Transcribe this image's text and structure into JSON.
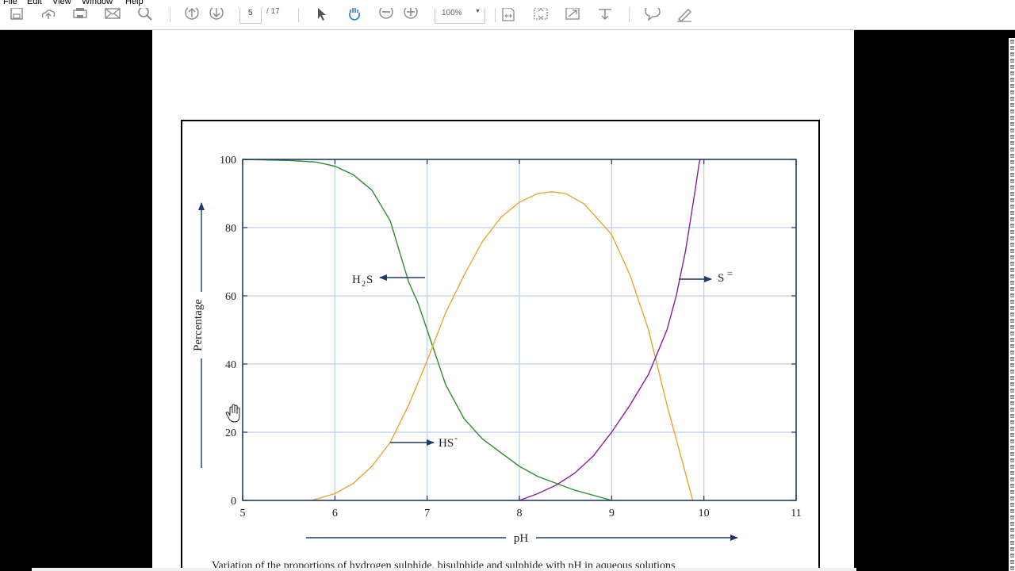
{
  "menu": {
    "items": [
      "File",
      "Edit",
      "View",
      "Window",
      "Help"
    ]
  },
  "toolbar": {
    "page_current": "5",
    "page_total": "/ 17",
    "zoom": "100%",
    "icons": [
      "save-icon",
      "upload-icon",
      "print-icon",
      "email-icon",
      "search-icon",
      "page-up-icon",
      "page-down-icon",
      "select-arrow-icon",
      "hand-icon",
      "zoom-out-icon",
      "zoom-in-icon",
      "fit-width-icon",
      "fit-page-icon",
      "full-screen-icon",
      "scroll-down-icon",
      "comment-icon",
      "sign-icon"
    ]
  },
  "colors": {
    "axis": "#1f3a6e",
    "grid": "#b9cfe6",
    "h2s": "#2e8b2e",
    "hs": "#e8a630",
    "s": "#8b1e9b",
    "arrow": "#1f3a6e"
  },
  "document": {
    "caption": "Variation of the proportions of hydrogen sulphide, bisulphide and sulphide with pH in aqueous solutions"
  },
  "chart_data": {
    "type": "line",
    "xlabel": "pH",
    "ylabel": "Percentage",
    "xlim": [
      5,
      11
    ],
    "ylim": [
      0,
      100
    ],
    "xticks": [
      5,
      6,
      7,
      8,
      9,
      10,
      11
    ],
    "yticks": [
      0,
      20,
      40,
      60,
      80,
      100
    ],
    "grid": true,
    "series": [
      {
        "name": "H₂S",
        "label_main": "H",
        "label_sub": "2",
        "label_tail": "S",
        "color_key": "h2s",
        "points": [
          [
            5,
            100
          ],
          [
            5.5,
            99.7
          ],
          [
            5.8,
            99.2
          ],
          [
            6,
            98
          ],
          [
            6.2,
            95.5
          ],
          [
            6.4,
            91
          ],
          [
            6.6,
            82
          ],
          [
            6.8,
            64
          ],
          [
            6.9,
            58
          ],
          [
            7,
            50
          ],
          [
            7.1,
            42
          ],
          [
            7.2,
            34
          ],
          [
            7.4,
            24
          ],
          [
            7.6,
            18
          ],
          [
            7.8,
            14
          ],
          [
            8,
            10
          ],
          [
            8.2,
            7
          ],
          [
            8.4,
            5
          ],
          [
            8.6,
            3
          ],
          [
            8.8,
            1.5
          ],
          [
            9,
            0
          ]
        ]
      },
      {
        "name": "HS⁻",
        "label_main": "HS",
        "label_sup": "-",
        "color_key": "hs",
        "points": [
          [
            5.75,
            0
          ],
          [
            6,
            2
          ],
          [
            6.2,
            5
          ],
          [
            6.4,
            10
          ],
          [
            6.6,
            17
          ],
          [
            6.8,
            28
          ],
          [
            7,
            41
          ],
          [
            7.2,
            55
          ],
          [
            7.4,
            66
          ],
          [
            7.6,
            76
          ],
          [
            7.8,
            83
          ],
          [
            8,
            87.5
          ],
          [
            8.2,
            90
          ],
          [
            8.35,
            90.5
          ],
          [
            8.5,
            90
          ],
          [
            8.7,
            87
          ],
          [
            9,
            78
          ],
          [
            9.2,
            66
          ],
          [
            9.4,
            50
          ],
          [
            9.6,
            28
          ],
          [
            9.8,
            8
          ],
          [
            9.88,
            0
          ]
        ]
      },
      {
        "name": "S⁼",
        "label_main": "S",
        "label_sup": "=",
        "color_key": "s",
        "points": [
          [
            8,
            0
          ],
          [
            8.2,
            2
          ],
          [
            8.4,
            4.5
          ],
          [
            8.6,
            8
          ],
          [
            8.8,
            13
          ],
          [
            9,
            20
          ],
          [
            9.2,
            28
          ],
          [
            9.4,
            37
          ],
          [
            9.6,
            50
          ],
          [
            9.7,
            60
          ],
          [
            9.8,
            73
          ],
          [
            9.9,
            90
          ],
          [
            9.95,
            99
          ],
          [
            9.96,
            100
          ]
        ]
      }
    ]
  }
}
